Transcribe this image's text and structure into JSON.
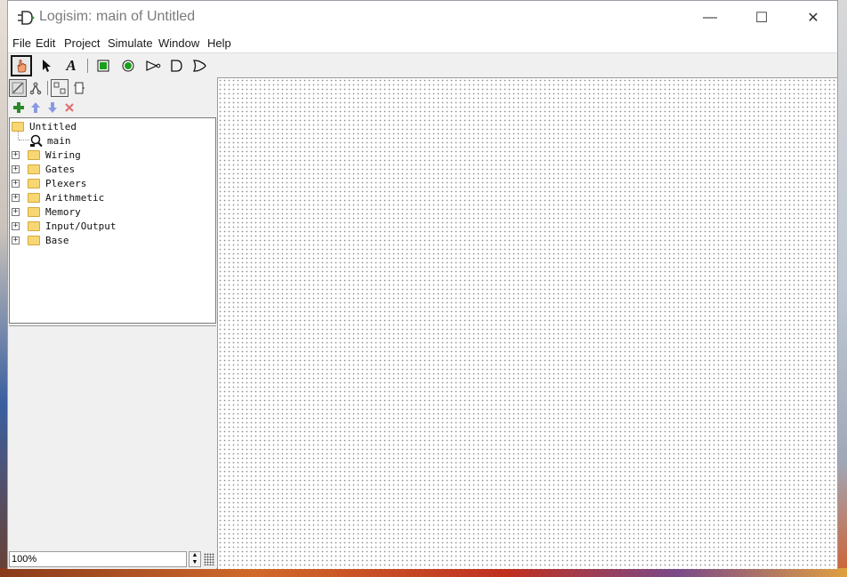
{
  "window": {
    "title": "Logisim: main of Untitled"
  },
  "window_controls": {
    "minimize": "—",
    "maximize": "☐",
    "close": "✕"
  },
  "menu": [
    "File",
    "Edit",
    "Project",
    "Simulate",
    "Window",
    "Help"
  ],
  "toolbar": {
    "tools": [
      {
        "name": "poke-tool",
        "icon": "hand-icon",
        "selected": true
      },
      {
        "name": "edit-tool",
        "icon": "arrow-cursor-icon",
        "selected": false
      },
      {
        "name": "text-tool",
        "icon": "text-A-icon",
        "label": "A",
        "selected": false
      },
      {
        "name": "input-pin-tool",
        "icon": "square-pin-icon",
        "selected": false
      },
      {
        "name": "output-pin-tool",
        "icon": "round-pin-icon",
        "selected": false
      },
      {
        "name": "not-gate-tool",
        "icon": "not-gate-icon",
        "selected": false
      },
      {
        "name": "and-gate-tool",
        "icon": "and-gate-icon",
        "selected": false
      },
      {
        "name": "or-gate-tool",
        "icon": "or-gate-icon",
        "selected": false
      }
    ]
  },
  "explorer": {
    "project": "Untitled",
    "circuit": "main",
    "libraries": [
      "Wiring",
      "Gates",
      "Plexers",
      "Arithmetic",
      "Memory",
      "Input/Output",
      "Base"
    ]
  },
  "zoom": {
    "value": "100%"
  },
  "colors": {
    "accent_green": "#1aa01a",
    "add_green": "#2a8a2a",
    "arrow_blue": "#8a9ae0",
    "delete_red": "#e07070",
    "folder": "#f7d774"
  }
}
